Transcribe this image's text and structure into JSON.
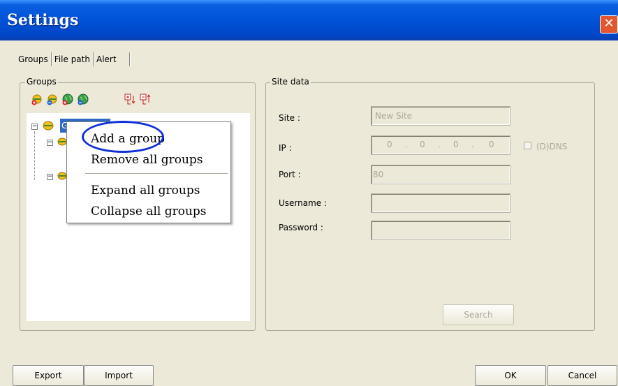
{
  "window": {
    "title": "Settings",
    "close_glyph": "✕"
  },
  "tabs": [
    {
      "label": "Groups"
    },
    {
      "label": "File path"
    },
    {
      "label": "Alert"
    }
  ],
  "groups_panel": {
    "legend": "Groups",
    "toolbar": [
      "add-group-icon",
      "remove-group-icon",
      "add-site-icon",
      "remove-site-icon",
      "expand-all-icon",
      "collapse-all-icon"
    ],
    "tree": {
      "root_label": "Groups",
      "root_selected": true
    }
  },
  "context_menu": {
    "items": [
      "Add a group",
      "Remove all groups",
      "Expand all groups",
      "Collapse all groups"
    ]
  },
  "site_data": {
    "legend": "Site data",
    "site_label": "Site :",
    "site_value": "New Site",
    "ip_label": "IP :",
    "ip_octets": [
      "0",
      "0",
      "0",
      "0"
    ],
    "ddns_label": "(D)DNS",
    "port_label": "Port :",
    "port_value": "80",
    "username_label": "Username :",
    "username_value": "",
    "password_label": "Password :",
    "password_value": "",
    "search_button": "Search"
  },
  "footer": {
    "export_button": "Export",
    "import_button": "Import",
    "ok_button": "OK",
    "cancel_button": "Cancel"
  },
  "colors": {
    "titlebar": "#0052d6",
    "window_bg": "#ece9d8",
    "highlight_ring": "#1030d8",
    "selection": "#316ac5"
  }
}
